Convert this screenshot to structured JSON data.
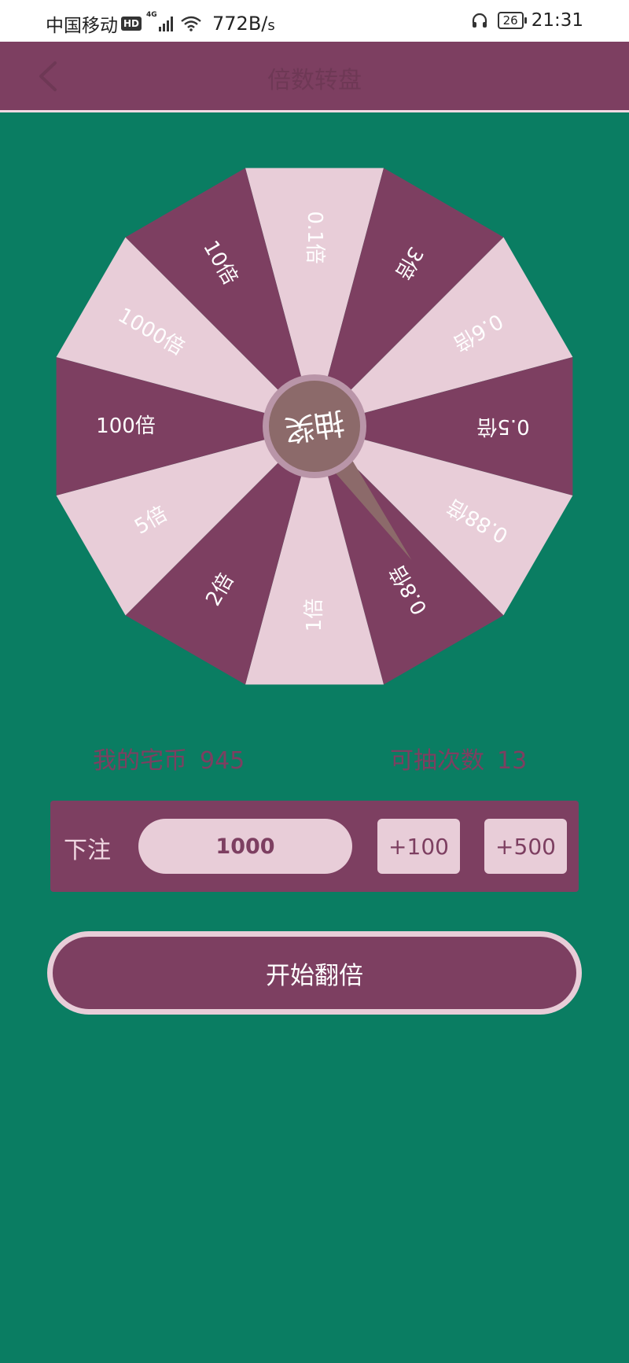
{
  "status_bar": {
    "carrier": "中国移动",
    "hd": "HD",
    "network": "4G",
    "speed": "772B/",
    "speed_unit": "s",
    "battery": "26",
    "time": "21:31"
  },
  "header": {
    "title": "倍数转盘"
  },
  "wheel": {
    "center_label": "抽奖",
    "segments": [
      "0.1倍",
      "3倍",
      "0.6倍",
      "0.5倍",
      "0.88倍",
      "0.8倍",
      "1倍",
      "2倍",
      "5倍",
      "100倍",
      "1000倍",
      "10倍"
    ],
    "pointer_segment": "0.8倍",
    "colors": {
      "dark": "#7d3f61",
      "light": "#e8cdd8",
      "hub": "#8c6a6a",
      "hub_ring": "#b995a8"
    }
  },
  "info": {
    "coins_label": "我的宅币",
    "coins_value": "945",
    "draws_label": "可抽次数",
    "draws_value": "13"
  },
  "bet": {
    "label": "下注",
    "value": "1000",
    "plus100_label": "+100",
    "plus500_label": "+500"
  },
  "start_button": {
    "label": "开始翻倍"
  },
  "colors": {
    "background": "#0a7d62",
    "primary": "#7d3f61",
    "accent": "#e8cdd8"
  }
}
